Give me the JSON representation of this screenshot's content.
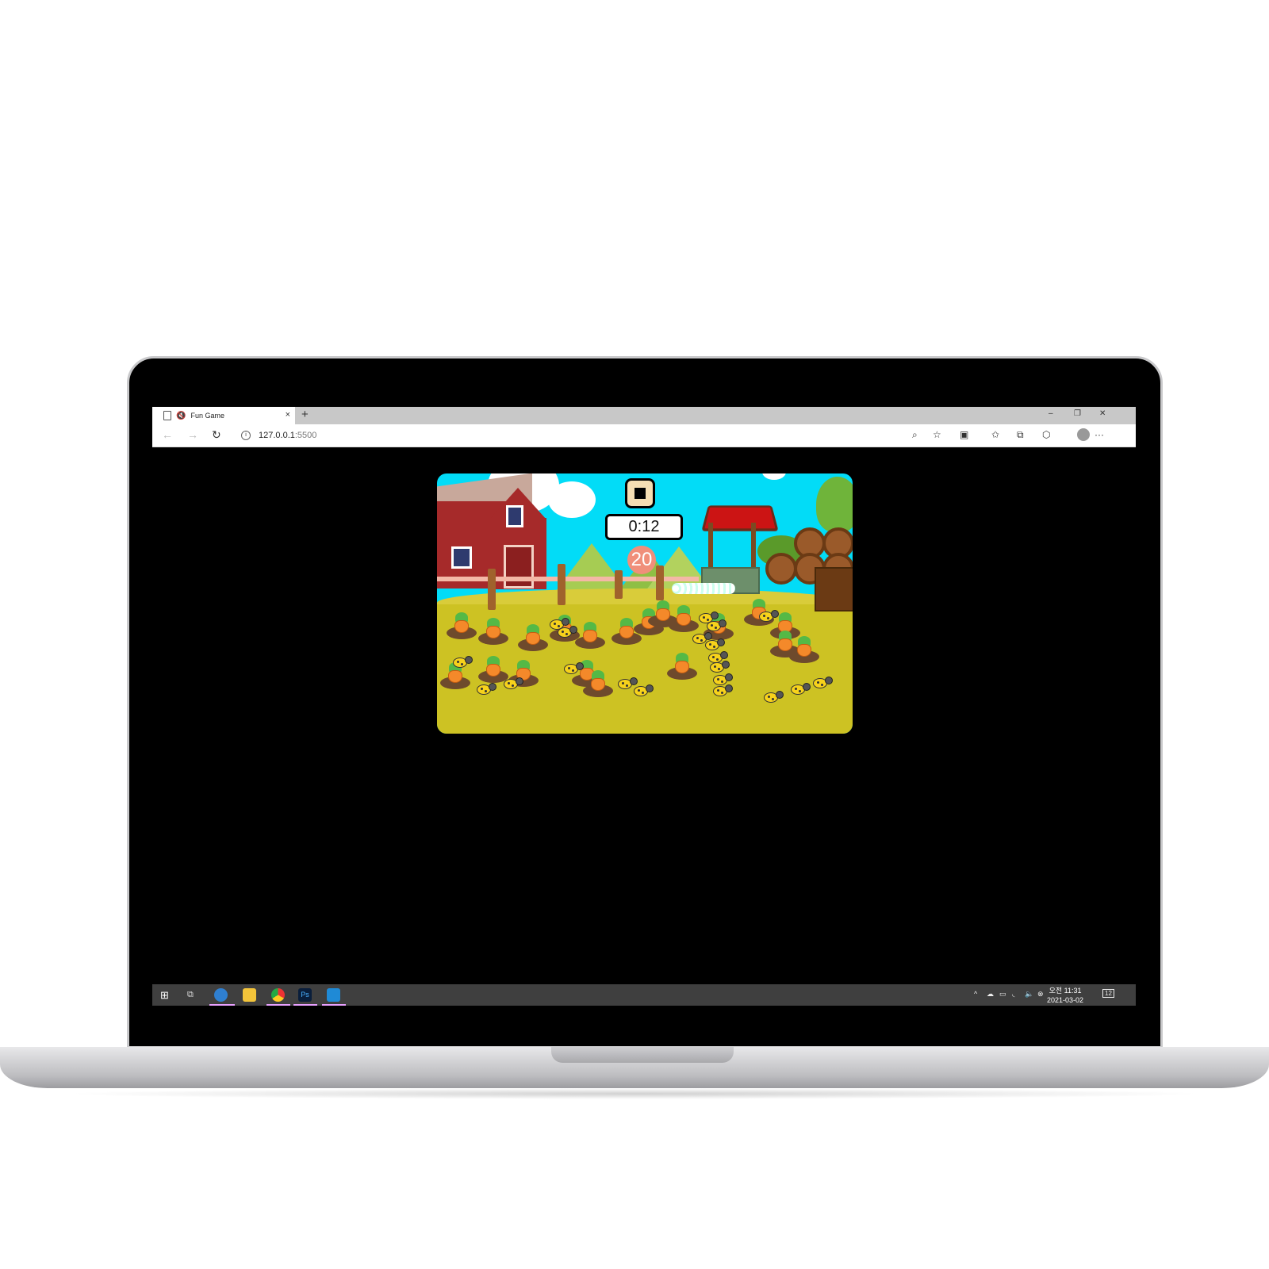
{
  "browser": {
    "tab_title": "Fun Game",
    "tab_close": "×",
    "new_tab": "+",
    "url_host": "127.0.0.1",
    "url_port": ":5500",
    "win_min": "–",
    "win_restore": "❐",
    "win_close": "✕",
    "back": "←",
    "forward": "→",
    "refresh": "↻",
    "more": "···"
  },
  "game": {
    "timer": "0:12",
    "carrot_count": "20",
    "colors": {
      "sky": "#02dcf7",
      "grass": "#cdc223",
      "stop_button": "#f5deb3",
      "counter": "#f08f7a"
    }
  },
  "taskbar": {
    "time": "오전 11:31",
    "date": "2021-03-02",
    "notifications": "12",
    "apps": [
      "start-icon",
      "task-view-icon",
      "edge-icon",
      "file-explorer-icon",
      "chrome-icon",
      "photoshop-icon",
      "vscode-icon"
    ],
    "ps_label": "Ps"
  }
}
